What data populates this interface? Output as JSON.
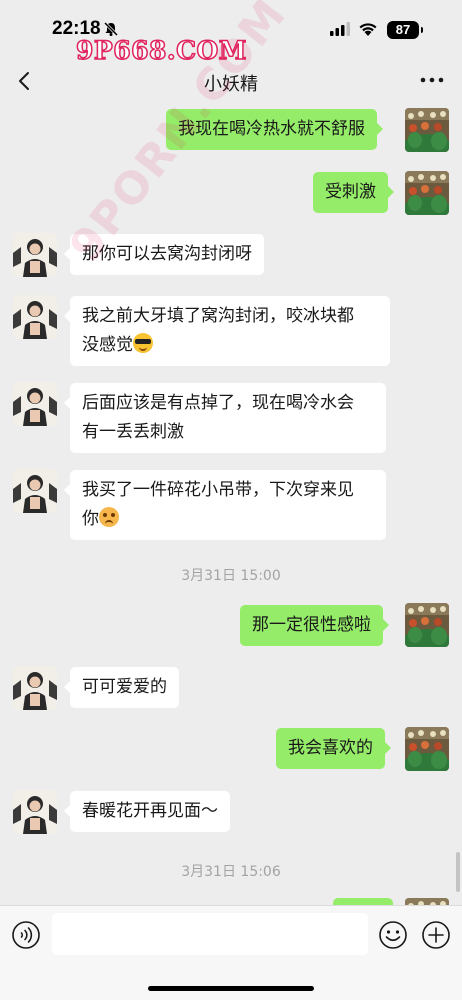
{
  "status_bar": {
    "time": "22:18",
    "battery": "87"
  },
  "watermark": {
    "top": "9P668.COM",
    "diagonal": "9PORN.COM"
  },
  "nav": {
    "title": "小妖精"
  },
  "messages": [
    {
      "side": "right",
      "text": "我现在喝冷热水就不舒服"
    },
    {
      "side": "right",
      "text": "受刺激"
    },
    {
      "side": "left",
      "text": "那你可以去窝沟封闭呀"
    },
    {
      "side": "left",
      "line1": " 我之前大牙填了窝沟封闭，咬冰块都",
      "line2": "没感觉",
      "emoji": "cool"
    },
    {
      "side": "left",
      "line1": "后面应该是有点掉了，现在喝冷水会",
      "line2": "有一丢丢刺激"
    },
    {
      "side": "left",
      "line1": "我买了一件碎花小吊带，下次穿来见",
      "line2": "你",
      "emoji": "angry"
    },
    {
      "type": "time",
      "text": "3月31日 15:00"
    },
    {
      "side": "right",
      "text": "那一定很性感啦"
    },
    {
      "side": "left",
      "text": "可可爱爱的"
    },
    {
      "side": "right",
      "text": "我会喜欢的"
    },
    {
      "side": "left",
      "text": "春暖花开再见面～"
    },
    {
      "type": "time",
      "text": "3月31日 15:06"
    }
  ],
  "input": {
    "value": "",
    "placeholder": ""
  },
  "colors": {
    "background": "#ededed",
    "bubble_self": "#95ec69",
    "bubble_other": "#ffffff",
    "watermark": "#e0245e"
  },
  "icons": [
    "back-icon",
    "more-icon",
    "voice-icon",
    "emoji-icon",
    "plus-icon",
    "mute-icon",
    "signal-icon",
    "wifi-icon"
  ]
}
